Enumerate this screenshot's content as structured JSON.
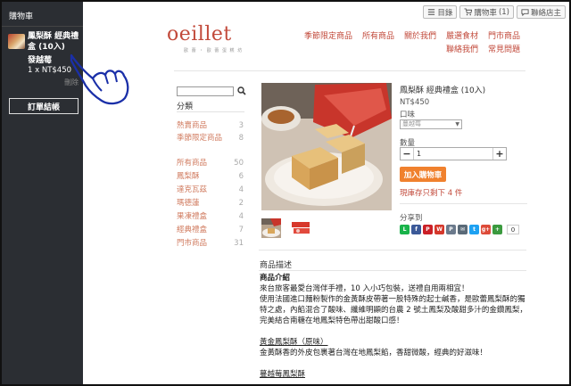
{
  "sidebar": {
    "title": "購物車",
    "cart_item": {
      "name": "鳳梨酥 經典禮盒 (10入)",
      "variant": "發越莓",
      "qty_price": "1 x NT$450",
      "remove": "刪除"
    },
    "checkout": "訂單結帳"
  },
  "utility": {
    "catalog": "目錄",
    "cart": "購物車",
    "cart_count": "(1)",
    "contact": "聯絡店主"
  },
  "brand": {
    "logo": "oeillet",
    "tagline": "歐 蕾 ・ 歐 蕾 蛋 糕 坊"
  },
  "nav": {
    "row1": [
      "季節限定商品",
      "所有商品",
      "關於我們",
      "嚴選食材",
      "門市商品"
    ],
    "row2": [
      "聯絡我們",
      "常見問題"
    ]
  },
  "categories": {
    "title": "分類",
    "items": [
      {
        "label": "熱賣商品",
        "count": "3"
      },
      {
        "label": "季節限定商品",
        "count": "8"
      },
      {
        "label": "所有商品",
        "count": "50"
      },
      {
        "label": "鳳梨酥",
        "count": "6"
      },
      {
        "label": "達克瓦茲",
        "count": "4"
      },
      {
        "label": "瑪德蓮",
        "count": "2"
      },
      {
        "label": "果凍禮盒",
        "count": "4"
      },
      {
        "label": "經典禮盒",
        "count": "7"
      },
      {
        "label": "門市商品",
        "count": "31"
      }
    ]
  },
  "product": {
    "title": "鳳梨酥 經典禮盒 (10入)",
    "price": "NT$450",
    "flavor_label": "口味",
    "flavor_selected": "蔓越莓",
    "qty_label": "數量",
    "qty_value": "1",
    "add_to_cart": "加入購物車",
    "stock_note": "現庫存只剩下 4 件",
    "share_label": "分享到",
    "share_count": "0"
  },
  "colors": {
    "accent": "#c24a3b",
    "button": "#f0812e",
    "sidebar_bg": "#2b2e33",
    "category_link": "#d07a5e"
  },
  "description": {
    "tab": "商品描述",
    "intro_title": "商品介紹",
    "intro_lines": [
      "來台旅客最愛台灣伴手禮，10 入小巧包裝，送禮自用兩相宜！",
      "使用法國進口麵粉製作的金黃酥皮帶著一股特殊的起士鹹香，是歐蕾鳳梨酥的獨",
      "特之處，內餡混合了酸味、纖維明顯的台農 2 號土鳳梨及酸甜多汁的金鑽鳳梨，",
      "完美結合南糖在地鳳梨特色帶出甜酸口感！"
    ],
    "sub1_title": "黃金鳳梨酥（原味）",
    "sub1_text": "金黃酥香的外皮包裹著台灣在地鳳梨餡，香甜微酸，經典的好滋味！",
    "sub2_title": "蔓越莓鳳梨酥"
  }
}
